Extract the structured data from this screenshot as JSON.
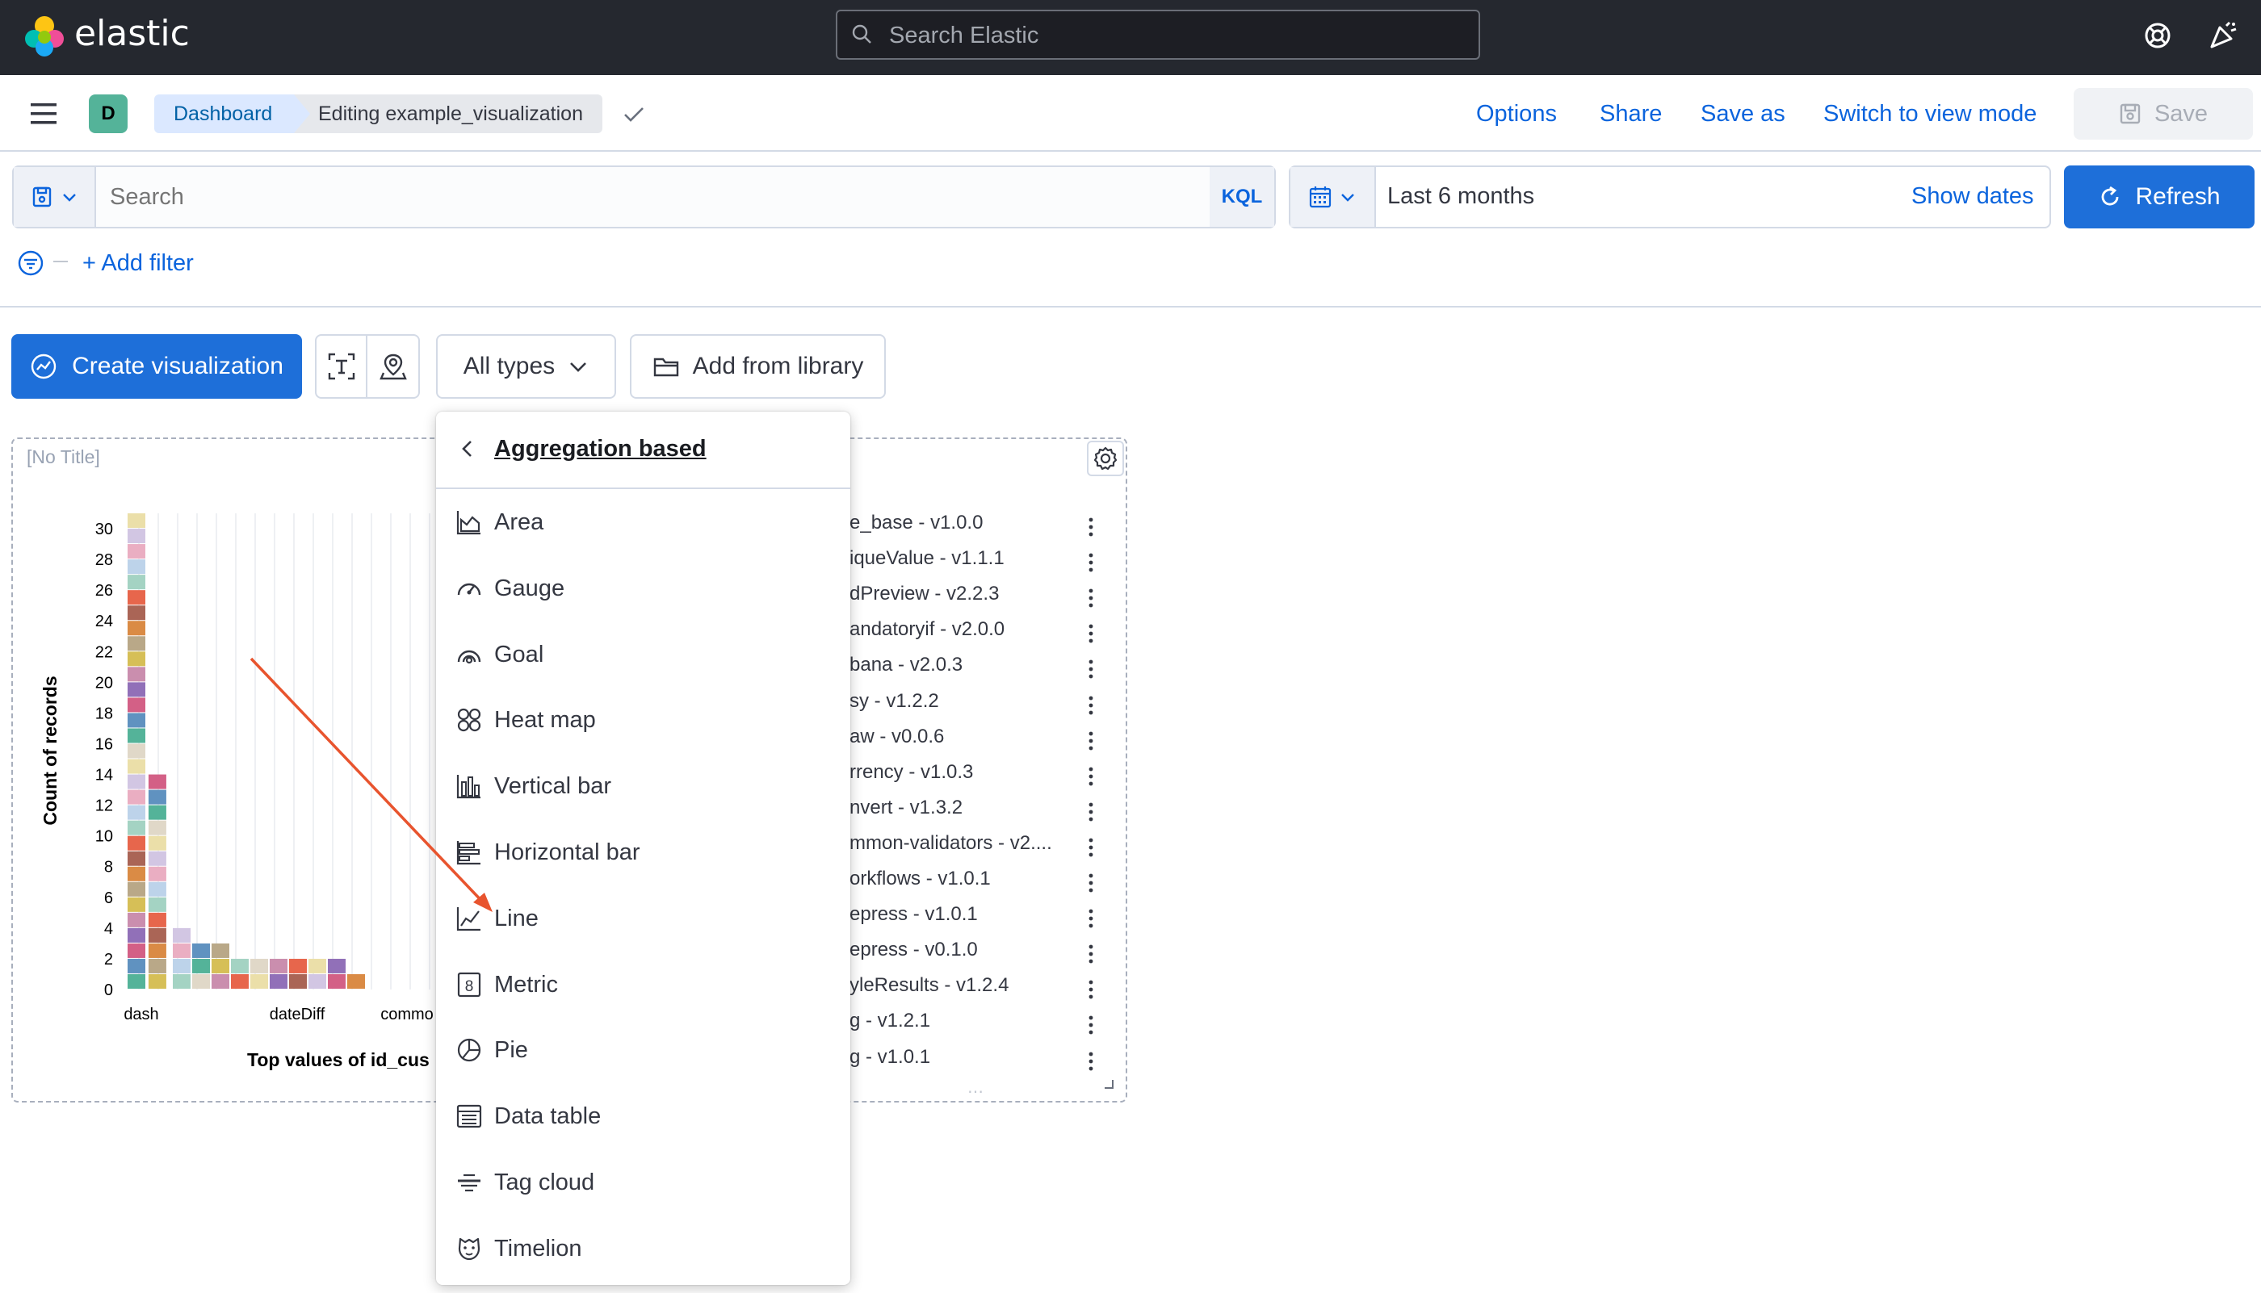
{
  "topbar": {
    "logo_text": "elastic",
    "search_placeholder": "Search Elastic"
  },
  "header": {
    "avatar_letter": "D",
    "breadcrumbs": [
      "Dashboard",
      "Editing example_visualization"
    ],
    "links": [
      "Options",
      "Share",
      "Save as",
      "Switch to view mode"
    ],
    "save_label": "Save"
  },
  "query": {
    "search_placeholder": "Search",
    "language": "KQL",
    "time_range": "Last 6 months",
    "show_dates": "Show dates",
    "refresh_label": "Refresh",
    "add_filter": "+ Add filter"
  },
  "toolbar": {
    "create_label": "Create visualization",
    "types_label": "All types",
    "library_label": "Add from library"
  },
  "panel": {
    "title": "[No Title]",
    "list": [
      "e_base - v1.0.0",
      "iqueValue - v1.1.1",
      "dPreview - v2.2.3",
      "andatoryif - v2.0.0",
      "bana - v2.0.3",
      "sy - v1.2.2",
      "aw - v0.0.6",
      "rrency - v1.0.3",
      "nvert - v1.3.2",
      "mmon-validators - v2....",
      "orkflows - v1.0.1",
      "epress - v1.0.1",
      "epress - v0.1.0",
      "yleResults - v1.2.4",
      "g - v1.2.1",
      "g - v1.0.1"
    ]
  },
  "chart_data": {
    "type": "bar",
    "stacked": true,
    "ylabel": "Count of records",
    "xlabel": "Top values of id_cus",
    "ylim": [
      0,
      31
    ],
    "yticks": [
      0,
      2,
      4,
      6,
      8,
      10,
      12,
      14,
      16,
      18,
      20,
      22,
      24,
      26,
      28,
      30
    ],
    "x_tick_labels": [
      "dash",
      "dateDiff",
      "commo"
    ],
    "values": [
      31,
      14,
      4,
      3,
      3,
      2,
      2,
      2,
      2,
      2,
      2,
      1
    ],
    "colors": [
      "#54b399",
      "#6092c0",
      "#d36086",
      "#9170b8",
      "#ca8eae",
      "#d6bf57",
      "#b9a888",
      "#da8b45",
      "#aa6556",
      "#e7664c",
      "#a4d3c3",
      "#bdd3ea",
      "#eaaec2",
      "#d2c6e3",
      "#ebdfa9",
      "#e0d8c8"
    ]
  },
  "popover": {
    "title": "Aggregation based",
    "items": [
      {
        "label": "Area",
        "icon": "area-chart-icon"
      },
      {
        "label": "Gauge",
        "icon": "gauge-icon"
      },
      {
        "label": "Goal",
        "icon": "goal-icon"
      },
      {
        "label": "Heat map",
        "icon": "heatmap-icon"
      },
      {
        "label": "Vertical bar",
        "icon": "vertical-bar-icon"
      },
      {
        "label": "Horizontal bar",
        "icon": "horizontal-bar-icon"
      },
      {
        "label": "Line",
        "icon": "line-chart-icon"
      },
      {
        "label": "Metric",
        "icon": "metric-icon"
      },
      {
        "label": "Pie",
        "icon": "pie-chart-icon"
      },
      {
        "label": "Data table",
        "icon": "data-table-icon"
      },
      {
        "label": "Tag cloud",
        "icon": "tag-cloud-icon"
      },
      {
        "label": "Timelion",
        "icon": "timelion-icon"
      }
    ]
  },
  "colors": {
    "primary": "#1e6fd9",
    "link": "#0b64dd",
    "topbar": "#25282f",
    "annotation_arrow": "#e8542e"
  }
}
